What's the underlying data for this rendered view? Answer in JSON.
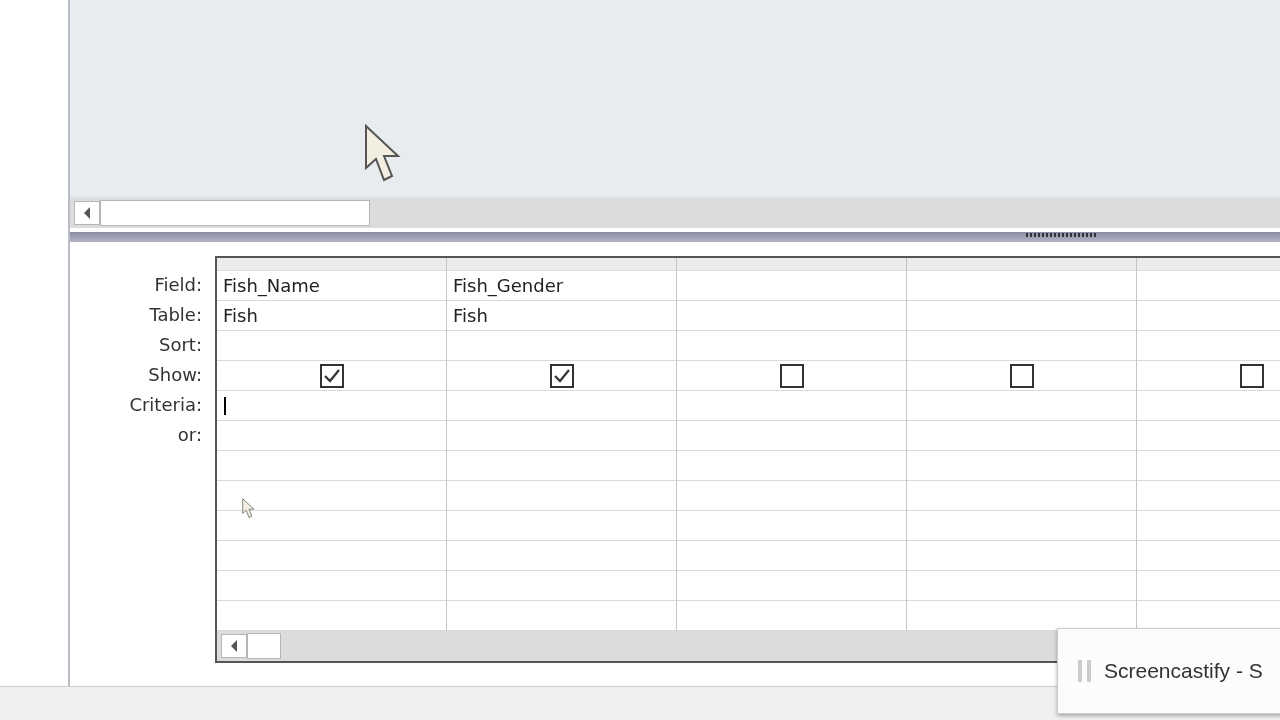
{
  "row_labels": [
    "Field:",
    "Table:",
    "Sort:",
    "Show:",
    "Criteria:",
    "or:"
  ],
  "columns": [
    {
      "field": "Fish_Name",
      "table": "Fish",
      "show": true,
      "editing": true
    },
    {
      "field": "Fish_Gender",
      "table": "Fish",
      "show": true,
      "editing": false
    },
    {
      "show": false,
      "editing": false
    },
    {
      "show": false,
      "editing": false
    },
    {
      "show": false,
      "editing": false
    }
  ],
  "notification": {
    "text": "Screencastify - S"
  }
}
